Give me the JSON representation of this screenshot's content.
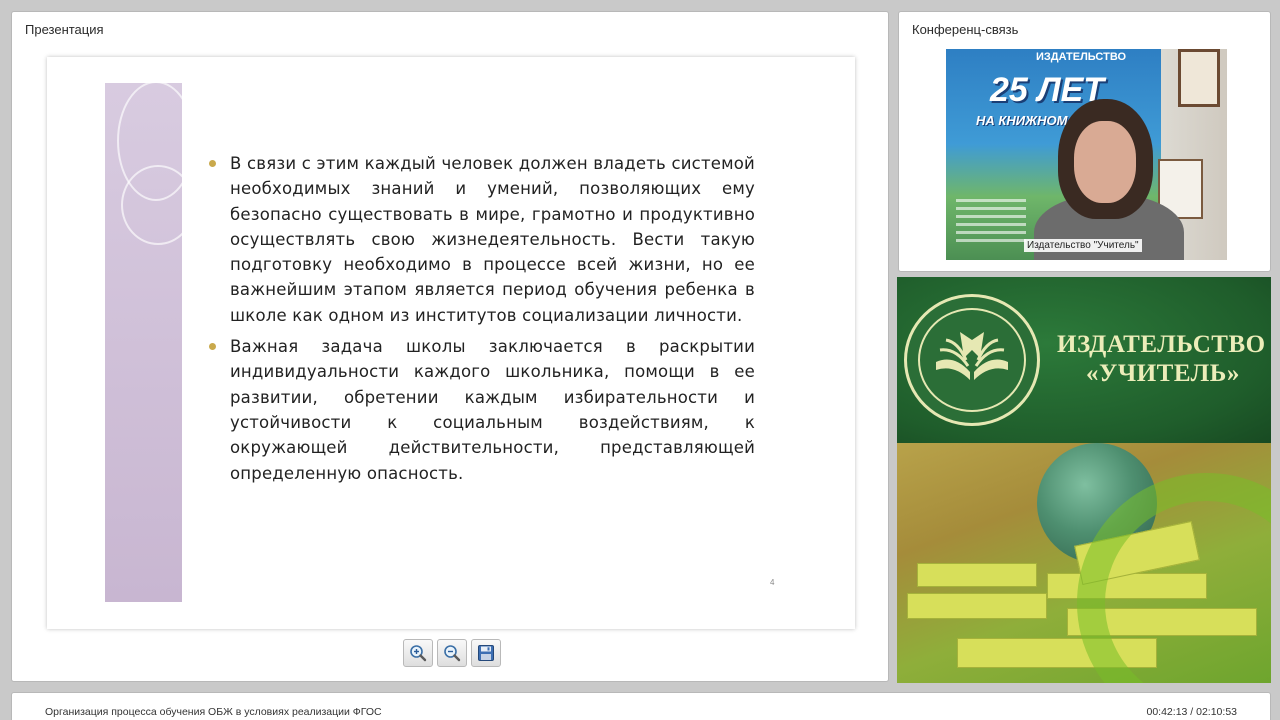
{
  "presentation": {
    "panel_title": "Презентация",
    "slide": {
      "bullets": [
        "В связи с этим каждый человек должен владеть системой необходимых знаний и умений, позволяющих ему безопасно существовать в мире, грамотно и продуктивно осуществлять свою жизнедеятельность. Вести такую подготовку необходимо в процессе всей жизни, но ее важнейшим этапом является период обучения ребенка в школе как одном из институтов социализации личности.",
        "Важная задача школы заключается в раскрытии индивидуальности каждого школьника, помощи в ее развитии, обретении каждым избирательности и устойчивости к социальным воздействиям, к окружающей действительности, представляющей определенную опасность."
      ],
      "page_number": "4"
    },
    "toolbar": {
      "zoom_in_icon": "zoom-in-icon",
      "zoom_out_icon": "zoom-out-icon",
      "save_icon": "save-icon"
    }
  },
  "conference": {
    "panel_title": "Конференц-связь",
    "camera_label": "Издательство \"Учитель\"",
    "poster_text": {
      "top": "ИЗДАТЕЛЬСТВО",
      "big": "25 ЛЕТ",
      "sub": "НА КНИЖНОМ Р"
    }
  },
  "ad": {
    "title_line1": "ИЗДАТЕЛЬСТВО",
    "title_line2": "«УЧИТЕЛЬ»"
  },
  "footer": {
    "title": "Организация процесса обучения ОБЖ в условиях реализации ФГОС",
    "time": "00:42:13 / 02:10:53"
  },
  "colors": {
    "background": "#c9c9c9",
    "slide_accent": "#c8b6d1",
    "bullet": "#c9a94c",
    "ad_green": "#1f5d2b",
    "ad_text": "#ecedb9"
  }
}
